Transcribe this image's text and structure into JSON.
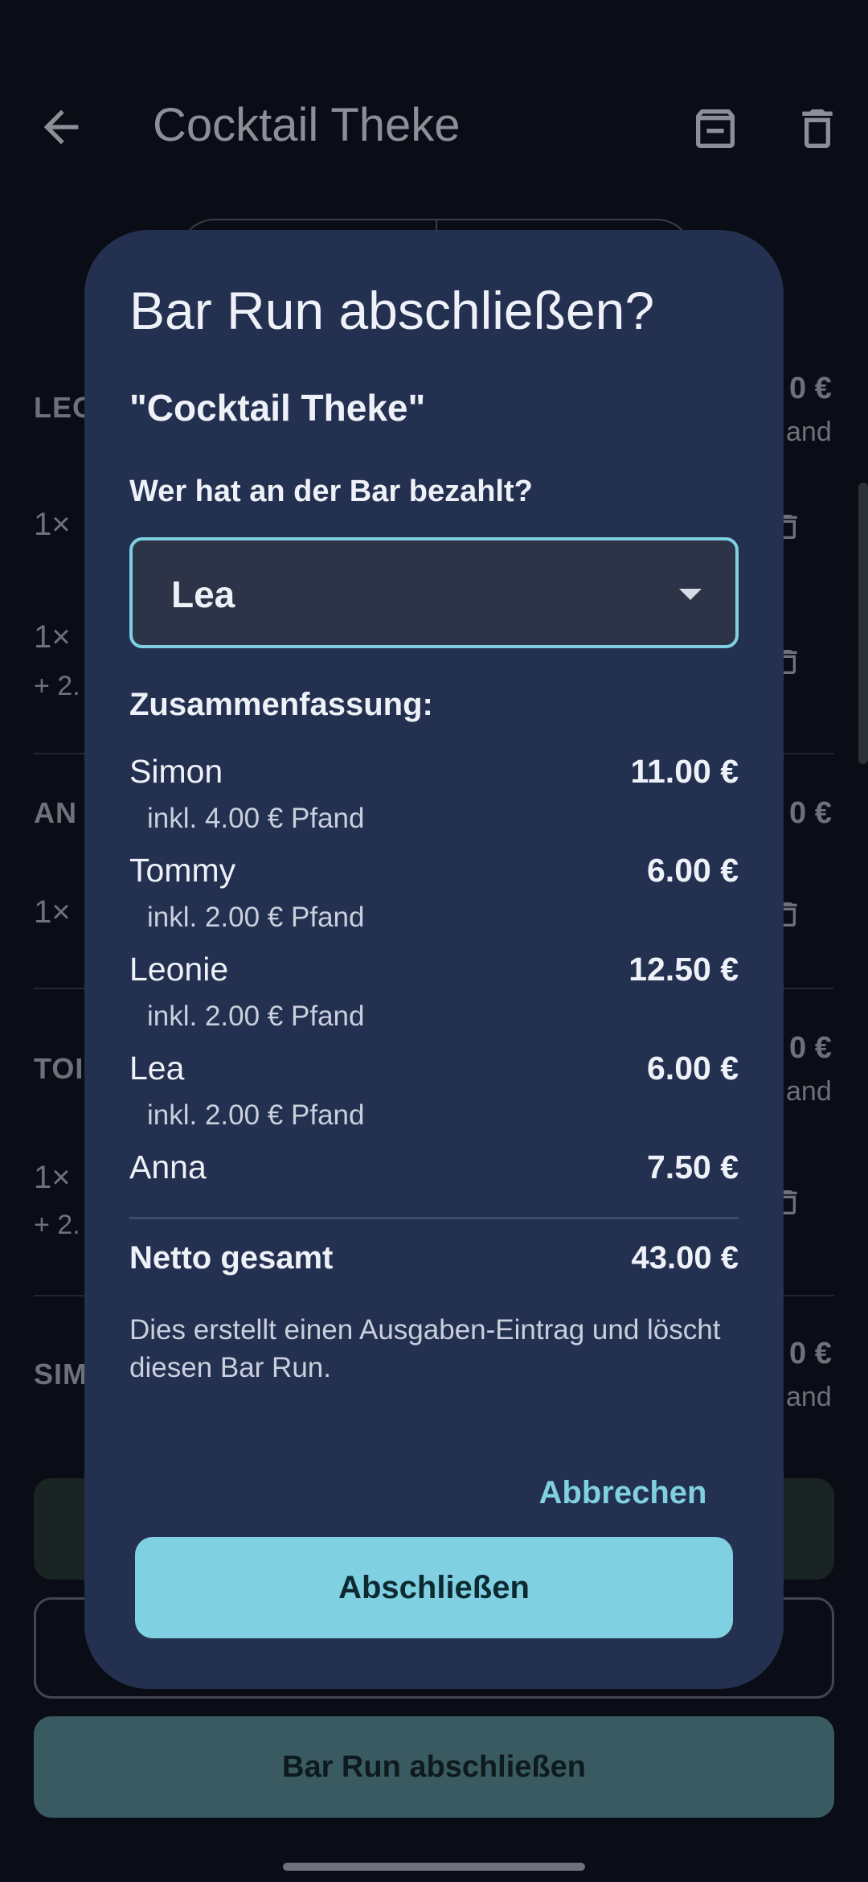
{
  "appbar": {
    "title": "Cocktail Theke",
    "back_icon": "arrow-back-icon",
    "archive_icon": "archive-icon",
    "delete_icon": "trash-icon"
  },
  "background": {
    "groups": [
      {
        "name_fragment": "LEO",
        "amount_fragment": "0 €",
        "sub_fragment": "and"
      },
      {
        "name_fragment": "AN",
        "amount_fragment": "0 €"
      },
      {
        "name_fragment": "TOI",
        "amount_fragment": "0 €",
        "sub_fragment": "and"
      },
      {
        "name_fragment": "SIM",
        "amount_fragment": "0 €",
        "sub_fragment": "and"
      }
    ],
    "items": [
      {
        "qty": "1×"
      },
      {
        "qty": "1×",
        "sub": "+ 2."
      },
      {
        "qty": "1×"
      },
      {
        "qty": "1×",
        "sub": "+ 2."
      }
    ],
    "bottom_button_label": "Bar Run abschließen"
  },
  "dialog": {
    "title": "Bar Run abschließen?",
    "run_name": "\"Cocktail Theke\"",
    "payer_question": "Wer hat an der Bar bezahlt?",
    "payer_selected": "Lea",
    "summary_heading": "Zusammenfassung:",
    "rows": [
      {
        "name": "Simon",
        "amount": "11.00 €",
        "pfand": "inkl. 4.00 € Pfand"
      },
      {
        "name": "Tommy",
        "amount": "6.00 €",
        "pfand": "inkl. 2.00 € Pfand"
      },
      {
        "name": "Leonie",
        "amount": "12.50 €",
        "pfand": "inkl. 2.00 € Pfand"
      },
      {
        "name": "Lea",
        "amount": "6.00 €",
        "pfand": "inkl. 2.00 € Pfand"
      },
      {
        "name": "Anna",
        "amount": "7.50 €",
        "pfand": ""
      }
    ],
    "total_label": "Netto gesamt",
    "total_amount": "43.00 €",
    "note": "Dies erstellt einen Ausgaben-Eintrag und löscht diesen Bar Run.",
    "cancel_label": "Abbrechen",
    "confirm_label": "Abschließen"
  },
  "colors": {
    "dialog_bg": "#233050",
    "accent": "#7fd0e0",
    "scrim_bg": "#0a0d15"
  }
}
